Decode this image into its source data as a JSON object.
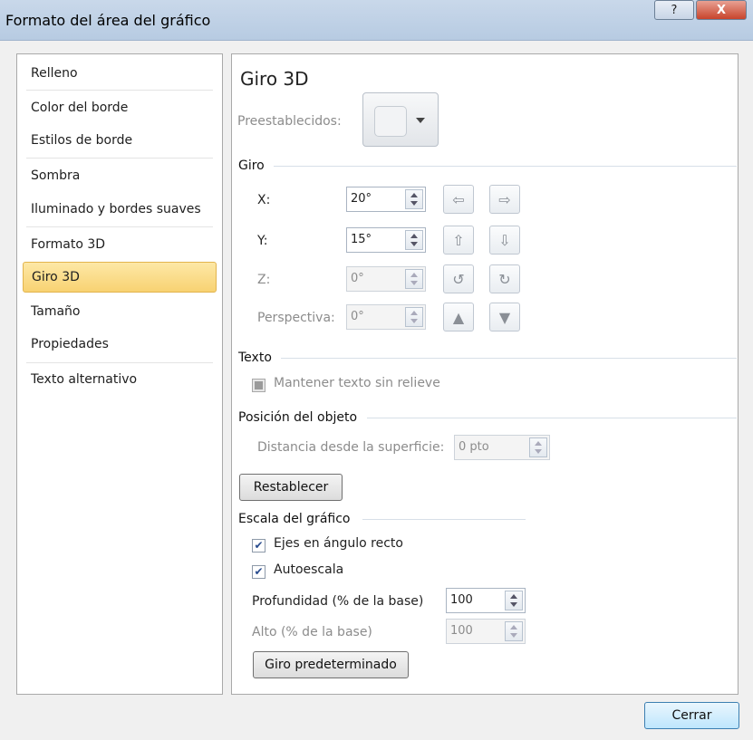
{
  "window": {
    "title": "Formato del área del gráfico",
    "help_label": "?",
    "close_label": "X"
  },
  "nav": {
    "items": [
      {
        "label": "Relleno"
      },
      {
        "label": "Color del borde"
      },
      {
        "label": "Estilos de borde"
      },
      {
        "label": "Sombra"
      },
      {
        "label": "Iluminado y bordes suaves"
      },
      {
        "label": "Formato 3D"
      },
      {
        "label": "Giro 3D",
        "selected": true
      },
      {
        "label": "Tamaño"
      },
      {
        "label": "Propiedades"
      },
      {
        "label": "Texto alternativo"
      }
    ]
  },
  "panel": {
    "title": "Giro 3D",
    "presets_label": "Preestablecidos:",
    "giro": {
      "heading": "Giro",
      "x": {
        "label": "X:",
        "value": "20°"
      },
      "y": {
        "label": "Y:",
        "value": "15°"
      },
      "z": {
        "label": "Z:",
        "value": "0°"
      },
      "perspective": {
        "label": "Perspectiva:",
        "value": "0°"
      }
    },
    "texto": {
      "heading": "Texto",
      "keep_flat_label": "Mantener texto sin relieve"
    },
    "position": {
      "heading": "Posición del objeto",
      "distance_label": "Distancia desde la superficie:",
      "distance_value": "0 pto"
    },
    "reset_label": "Restablecer",
    "scale": {
      "heading": "Escala del gráfico",
      "right_angle_label": "Ejes en ángulo recto",
      "right_angle_checked": true,
      "autoscale_label": "Autoescala",
      "autoscale_checked": true,
      "depth_label": "Profundidad (% de la base)",
      "depth_value": "100",
      "height_label": "Alto (% de la base)",
      "height_value": "100",
      "default_rotation_label": "Giro predeterminado"
    }
  },
  "footer": {
    "close_label": "Cerrar"
  },
  "colors": {
    "selected_bg": "#f8d272",
    "title_bar": "#b7cbe2"
  }
}
